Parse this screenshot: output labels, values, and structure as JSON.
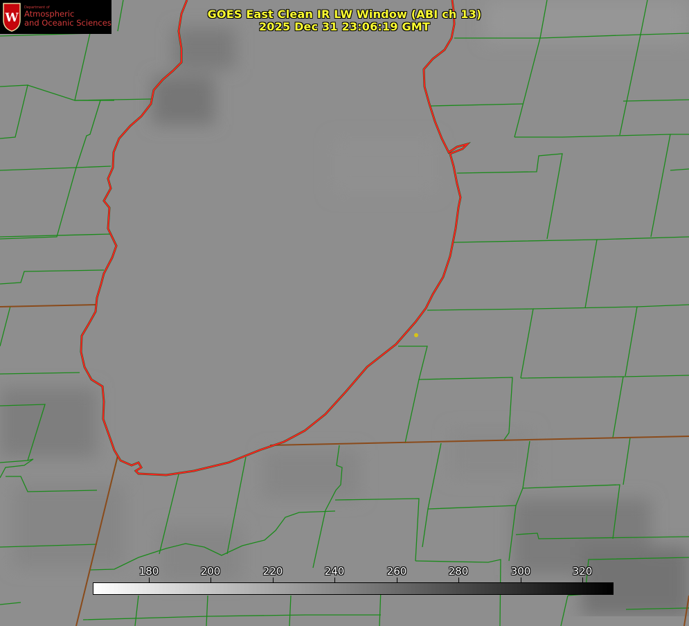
{
  "title": {
    "line1": "GOES East Clean IR LW Window (ABI ch 13)",
    "line2": "2025 Dec 31 23:06:19 GMT"
  },
  "logo": {
    "department": "Department of",
    "line1": "Atmospheric",
    "line2": "and Oceanic Sciences",
    "crest_letter": "W"
  },
  "colorbar": {
    "ticks": [
      "180",
      "200",
      "220",
      "240",
      "260",
      "280",
      "300",
      "320"
    ],
    "gradient_from": "#ffffff",
    "gradient_to": "#000000"
  },
  "colors": {
    "county_lines": "#1a8a1a",
    "coastline": "#ff2020",
    "state_border": "#8a4a1a",
    "title_text": "#ffff33",
    "site_marker": "#d8c418",
    "logo_red": "#c5050c"
  }
}
